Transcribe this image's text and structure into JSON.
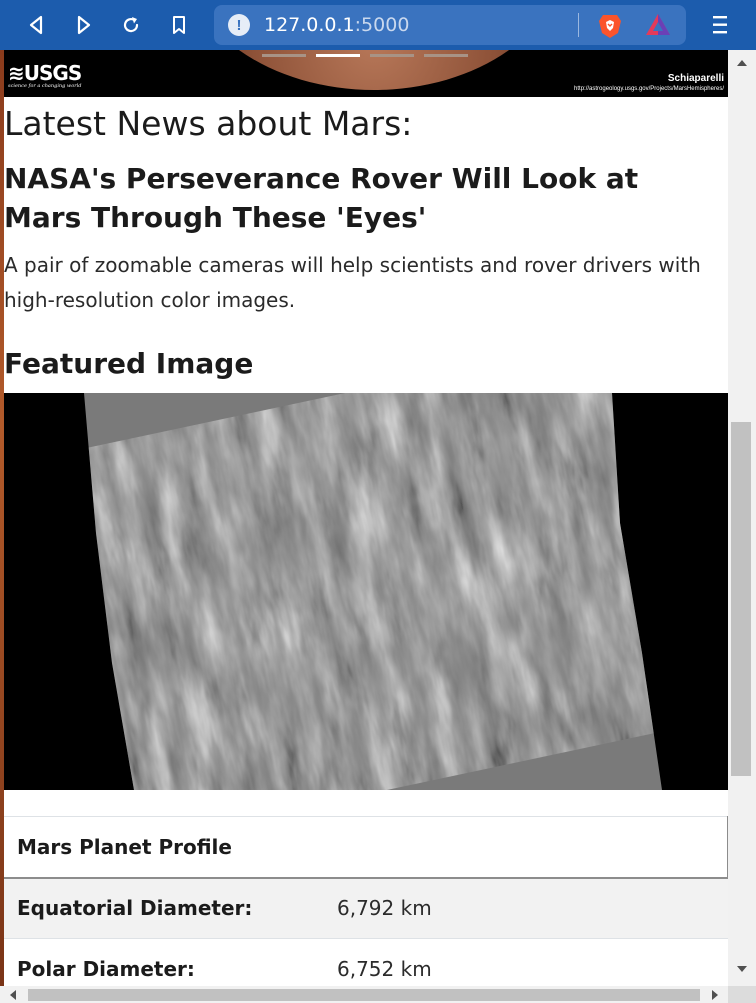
{
  "browser": {
    "url_host": "127.0.0.1",
    "url_port": ":5000",
    "icons": {
      "back": "back-arrow-icon",
      "forward": "forward-arrow-icon",
      "reload": "reload-icon",
      "bookmark": "bookmark-icon",
      "site_info": "info-icon",
      "brave_shields": "brave-lion-icon",
      "brave_rewards": "rewards-triangle-icon",
      "menu": "hamburger-menu-icon"
    },
    "colors": {
      "toolbar": "#1c5cad",
      "url_bar": "#3a73bf"
    }
  },
  "hero": {
    "logo_text": "USGS",
    "logo_tagline": "science for a changing world",
    "caption_title": "Schiaparelli",
    "caption_link": "http://astrogeology.usgs.gov/Projects/MarsHemispheres/"
  },
  "news": {
    "heading": "Latest News about Mars:",
    "title": "NASA's Perseverance Rover Will Look at Mars Through These 'Eyes'",
    "teaser": "A pair of zoomable cameras will help scientists and rover drivers with high-resolution color images."
  },
  "featured": {
    "heading": "Featured Image"
  },
  "facts": {
    "header": "Mars Planet Profile",
    "rows": [
      {
        "label": "Equatorial Diameter:",
        "value": "6,792 km"
      },
      {
        "label": "Polar Diameter:",
        "value": "6,752 km"
      }
    ]
  }
}
